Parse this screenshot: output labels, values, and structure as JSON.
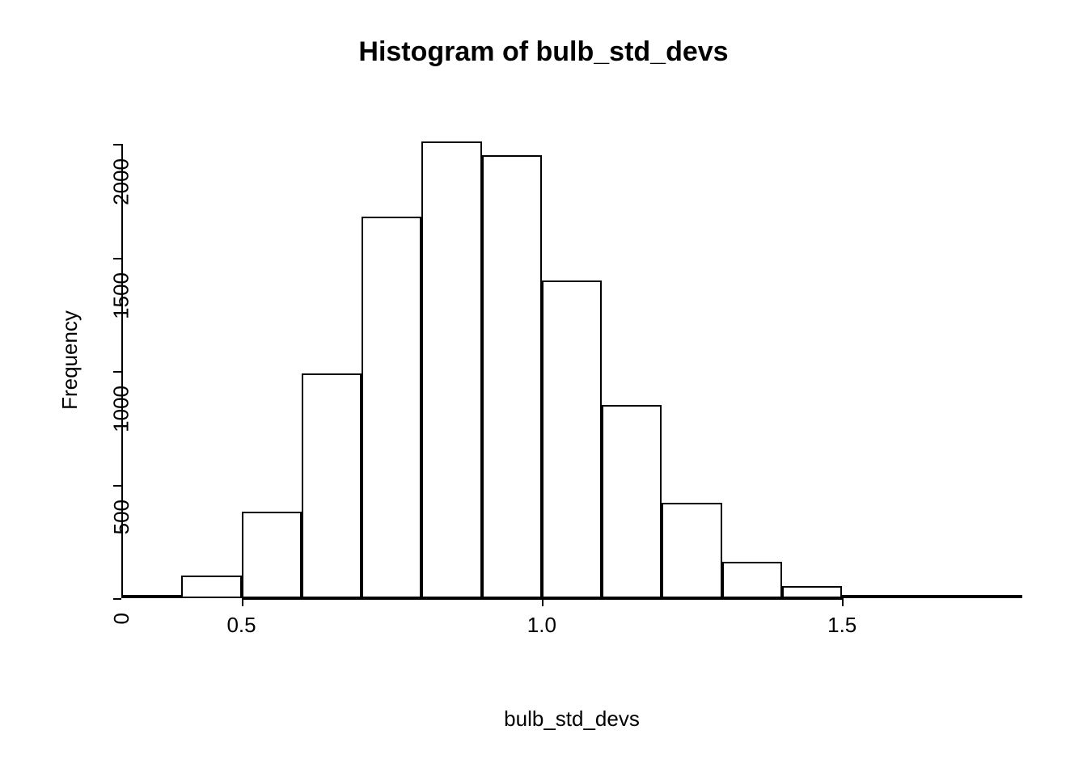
{
  "chart_data": {
    "type": "bar",
    "title": "Histogram of bulb_std_devs",
    "xlabel": "bulb_std_devs",
    "ylabel": "Frequency",
    "x_breaks": [
      0.3,
      0.4,
      0.5,
      0.6,
      0.7,
      0.8,
      0.9,
      1.0,
      1.1,
      1.2,
      1.3,
      1.4,
      1.5,
      1.6,
      1.7,
      1.8
    ],
    "values": [
      10,
      100,
      380,
      990,
      1680,
      2010,
      1950,
      1400,
      850,
      420,
      160,
      55,
      15,
      5,
      2
    ],
    "xlim": [
      0.3,
      1.8
    ],
    "ylim": [
      0,
      2100
    ],
    "x_ticks": [
      0.5,
      1.0,
      1.5
    ],
    "y_ticks": [
      0,
      500,
      1000,
      1500,
      2000
    ]
  }
}
